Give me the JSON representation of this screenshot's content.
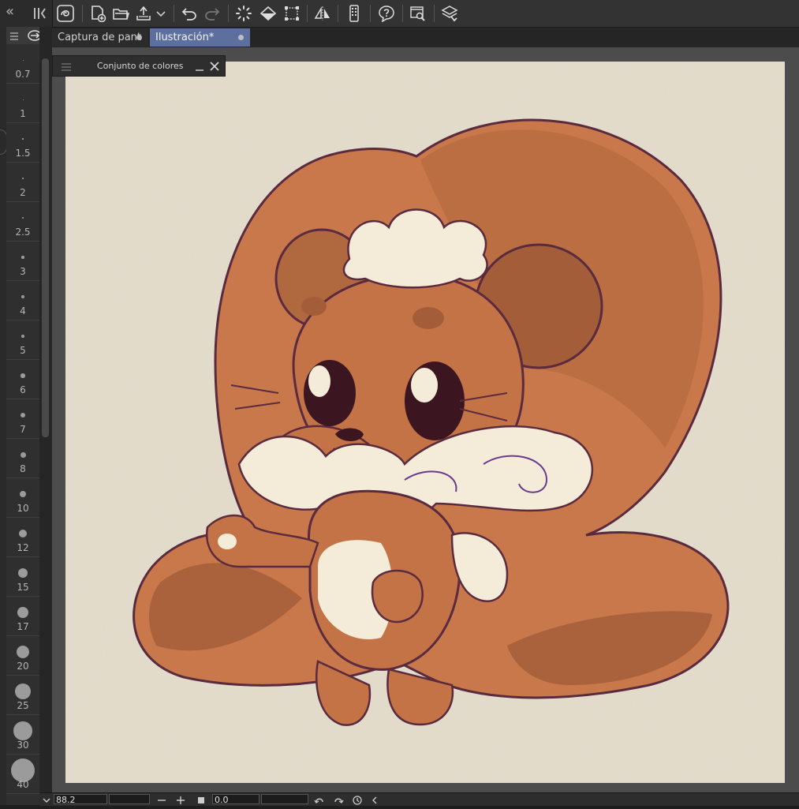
{
  "toolbar": {
    "collapse_label": "«",
    "icons": [
      "app-icon",
      "new-file-icon",
      "open-folder-icon",
      "export-icon",
      "dropdown-arrow-icon",
      "undo-icon",
      "redo-icon",
      "loading-spinner-icon",
      "fill-icon",
      "transform-icon",
      "flip-horizontal-icon",
      "smartphone-icon",
      "help-icon",
      "search-icon",
      "layers-icon"
    ]
  },
  "tabs": [
    {
      "label": "Captura de pant",
      "active": false
    },
    {
      "label": "Ilustración*",
      "active": true
    }
  ],
  "floating_panel": {
    "title": "Conjunto de colores"
  },
  "brush_sizes": [
    "0.7",
    "1",
    "1.5",
    "2",
    "2.5",
    "3",
    "4",
    "5",
    "6",
    "7",
    "8",
    "10",
    "12",
    "15",
    "17",
    "20",
    "25",
    "30",
    "40"
  ],
  "bottom_bar": {
    "zoom_value": "88.2",
    "rotation_value": "0.0"
  },
  "colors": {
    "canvas_paper": "#e4dccb",
    "fur": "#c8784a",
    "fur_shadow": "#9e5a38",
    "cream": "#f4ecd9",
    "outline": "#5a2a3e",
    "active_tab": "#5d6f9e"
  }
}
